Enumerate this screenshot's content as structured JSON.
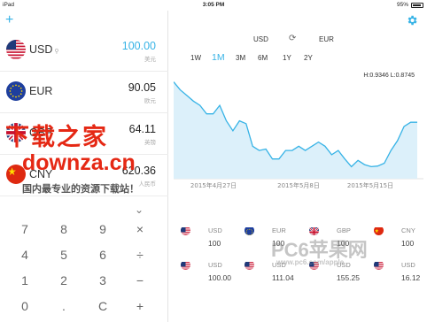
{
  "status_bar": {
    "device": "iPad",
    "time": "3:05 PM",
    "battery": "95%"
  },
  "header": {
    "add_icon": "plus-icon",
    "settings_icon": "gear-icon"
  },
  "currencies": [
    {
      "code": "USD",
      "amount": "100.00",
      "unit": "美元",
      "flag": "us-flag",
      "active": true
    },
    {
      "code": "EUR",
      "amount": "90.05",
      "unit": "欧元",
      "flag": "eu-flag",
      "active": false
    },
    {
      "code": "GBP",
      "amount": "64.11",
      "unit": "英镑",
      "flag": "uk-flag",
      "active": false
    },
    {
      "code": "CNY",
      "amount": "620.36",
      "unit": "人民币",
      "flag": "cn-flag",
      "active": false
    }
  ],
  "keypad": {
    "keys": [
      [
        "7",
        "8",
        "9",
        "×"
      ],
      [
        "4",
        "5",
        "6",
        "÷"
      ],
      [
        "1",
        "2",
        "3",
        "−"
      ],
      [
        "0",
        ".",
        "C",
        "+"
      ]
    ]
  },
  "pair": {
    "base": "USD",
    "quote": "EUR"
  },
  "ranges": [
    "1W",
    "1M",
    "3M",
    "6M",
    "1Y",
    "2Y"
  ],
  "active_range": "1M",
  "high_low": "H:0.9346  L:0.8745",
  "chart_data": {
    "type": "area",
    "x_tick_labels": [
      "2015年4月27日",
      "2015年5月8日",
      "2015年5月15日"
    ],
    "y": [
      0.9346,
      0.929,
      0.925,
      0.921,
      0.918,
      0.912,
      0.912,
      0.918,
      0.907,
      0.9,
      0.907,
      0.905,
      0.889,
      0.886,
      0.887,
      0.88,
      0.88,
      0.886,
      0.886,
      0.889,
      0.886,
      0.889,
      0.892,
      0.889,
      0.883,
      0.886,
      0.88,
      0.8745,
      0.879,
      0.876,
      0.8745,
      0.875,
      0.877,
      0.886,
      0.893,
      0.903,
      0.906,
      0.906
    ],
    "ylim": [
      0.866,
      0.935
    ],
    "color": "#37b3e6",
    "fill": "#dcf0fa"
  },
  "mini_grid": {
    "rows": [
      [
        {
          "flag": "us-flag",
          "code": "USD",
          "value": "100"
        },
        {
          "flag": "eu-flag",
          "code": "EUR",
          "value": "100"
        },
        {
          "flag": "uk-flag",
          "code": "GBP",
          "value": "100"
        },
        {
          "flag": "cn-flag",
          "code": "CNY",
          "value": "100"
        }
      ],
      [
        {
          "flag": "us-flag",
          "code": "USD",
          "value": "100.00"
        },
        {
          "flag": "us-flag",
          "code": "USD",
          "value": "111.04"
        },
        {
          "flag": "us-flag",
          "code": "USD",
          "value": "155.25"
        },
        {
          "flag": "us-flag",
          "code": "USD",
          "value": "16.12"
        }
      ]
    ]
  },
  "watermarks": {
    "big": "下载之家",
    "domain": "downza.cn",
    "sub": "国内最专业的资源下载站！",
    "pc6": "PC6苹果网",
    "pc6_url": "www.pc6.com/apple"
  }
}
